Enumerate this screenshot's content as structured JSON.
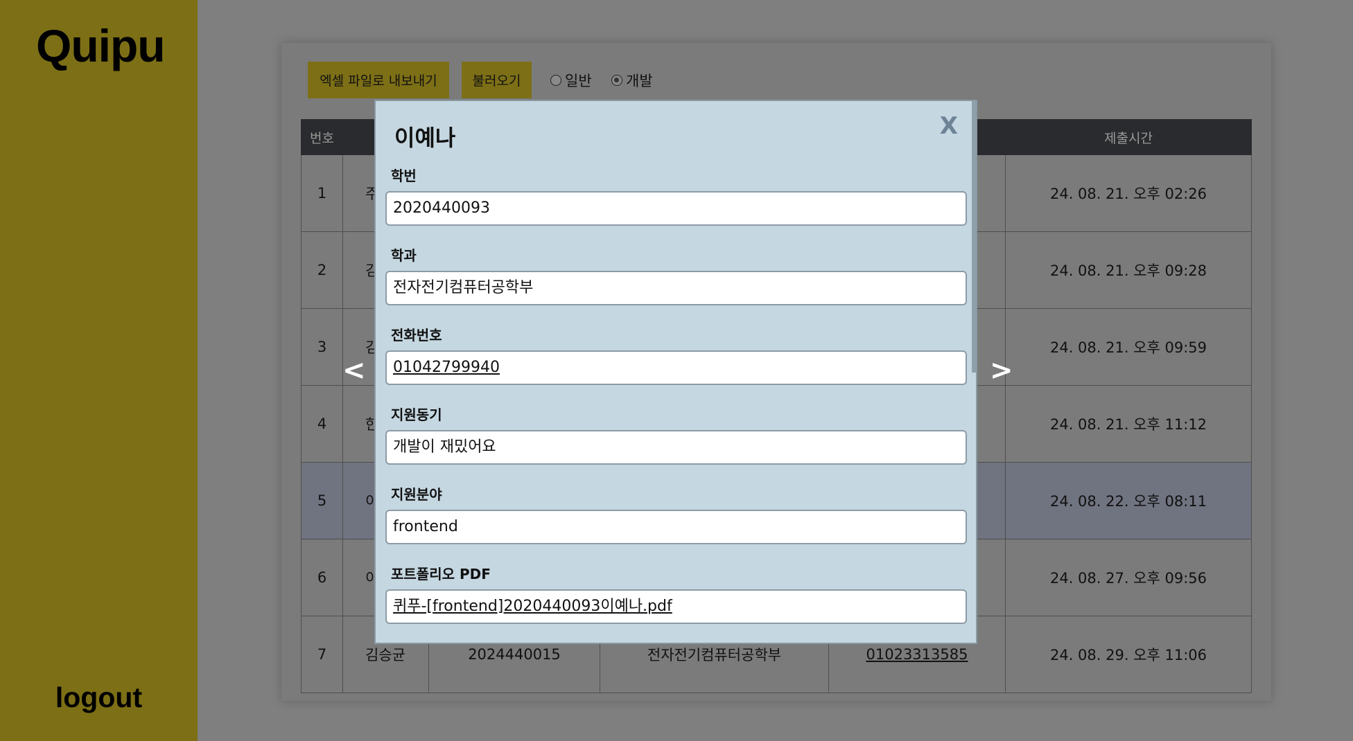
{
  "sidebar": {
    "brand": "Quipu",
    "logout_label": "logout"
  },
  "toolbar": {
    "export_label": "엑셀 파일로 내보내기",
    "load_label": "불러오기",
    "radios": [
      {
        "label": "일반",
        "selected": false
      },
      {
        "label": "개발",
        "selected": true
      }
    ]
  },
  "table": {
    "headers": [
      "번호",
      "",
      "",
      "",
      "",
      "제출시간"
    ],
    "rows": [
      {
        "num": "1",
        "name": "주",
        "sid": "",
        "dept": "",
        "phone": "",
        "time": "24. 08. 21. 오후 02:26"
      },
      {
        "num": "2",
        "name": "김",
        "sid": "",
        "dept": "",
        "phone": "",
        "time": "24. 08. 21. 오후 09:28"
      },
      {
        "num": "3",
        "name": "김",
        "sid": "",
        "dept": "",
        "phone": "",
        "time": "24. 08. 21. 오후 09:59"
      },
      {
        "num": "4",
        "name": "한",
        "sid": "",
        "dept": "",
        "phone": "",
        "time": "24. 08. 21. 오후 11:12"
      },
      {
        "num": "5",
        "name": "이",
        "sid": "",
        "dept": "",
        "phone": "",
        "time": "24. 08. 22. 오후 08:11"
      },
      {
        "num": "6",
        "name": "이",
        "sid": "",
        "dept": "",
        "phone": "",
        "time": "24. 08. 27. 오후 09:56"
      },
      {
        "num": "7",
        "name": "김승균",
        "sid": "2024440015",
        "dept": "전자전기컴퓨터공학부",
        "phone": "01023313585",
        "time": "24. 08. 29. 오후 11:06"
      }
    ],
    "selected_row": 5
  },
  "modal": {
    "name": "이예나",
    "close_label": "X",
    "prev_label": "<",
    "next_label": ">",
    "fields": [
      {
        "label": "학번",
        "value": "2020440093"
      },
      {
        "label": "학과",
        "value": "전자전기컴퓨터공학부"
      },
      {
        "label": "전화번호",
        "value": "01042799940"
      },
      {
        "label": "지원동기",
        "value": "개발이 재밌어요"
      },
      {
        "label": "지원분야",
        "value": "frontend"
      },
      {
        "label": "포트폴리오 PDF",
        "value": "퀴푸-[frontend]2020440093이예나.pdf"
      }
    ]
  }
}
